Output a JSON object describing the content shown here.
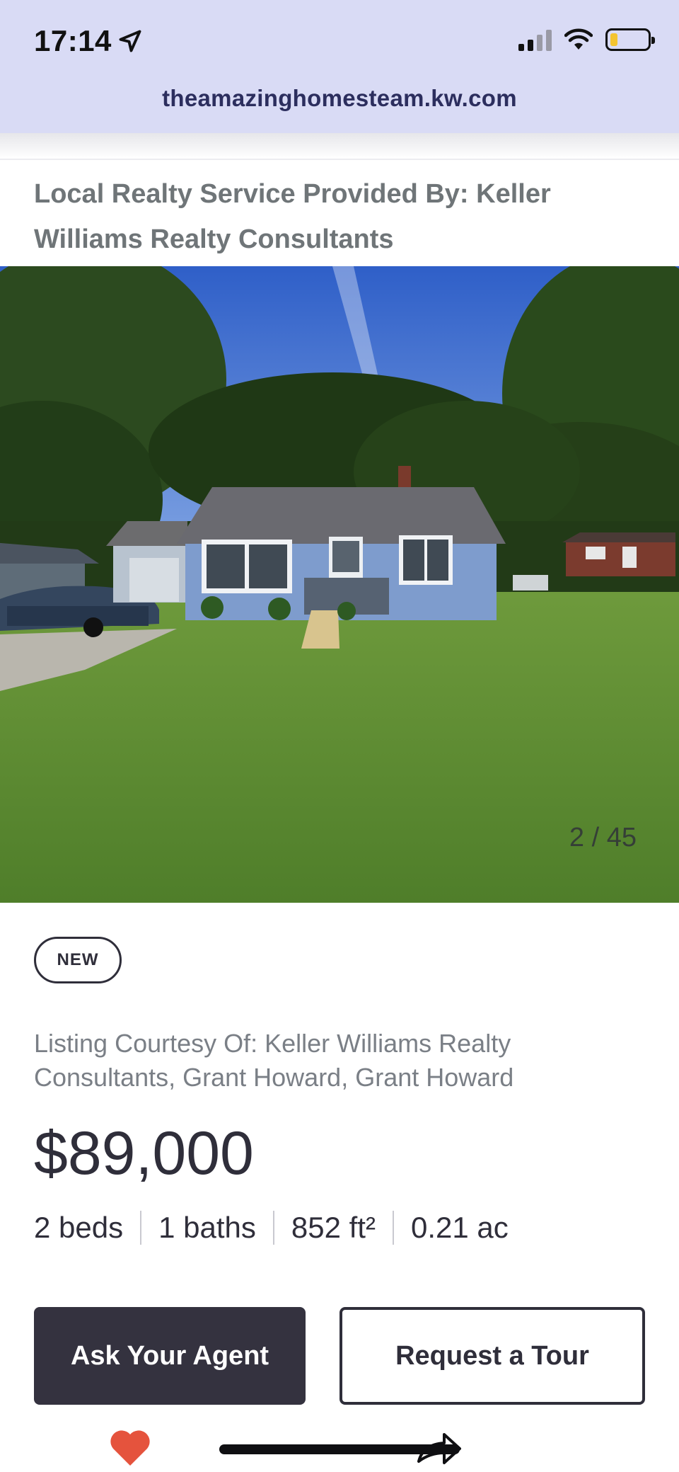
{
  "status_bar": {
    "time": "17:14",
    "battery_level": 0.2
  },
  "browser": {
    "url": "theamazinghomesteam.kw.com"
  },
  "listing": {
    "service_text": "Local Realty Service Provided By: Keller Williams Realty Consultants",
    "photo": {
      "counter": "2 / 45"
    },
    "badge": "NEW",
    "courtesy": "Listing Courtesy Of: Keller Williams Realty Consultants, Grant Howard, Grant Howard",
    "price": "$89,000",
    "specs": {
      "beds": "2 beds",
      "baths": "1 baths",
      "sqft": "852 ft²",
      "acres": "0.21 ac"
    }
  },
  "actions": {
    "ask_agent": "Ask Your Agent",
    "request_tour": "Request a Tour"
  },
  "colors": {
    "accent_dark": "#34323f",
    "heart": "#e5533d",
    "top_bar": "#d9dbf5"
  },
  "icons": [
    "location-arrow-icon",
    "signal-icon",
    "wifi-icon",
    "battery-icon",
    "heart-icon",
    "share-icon"
  ]
}
